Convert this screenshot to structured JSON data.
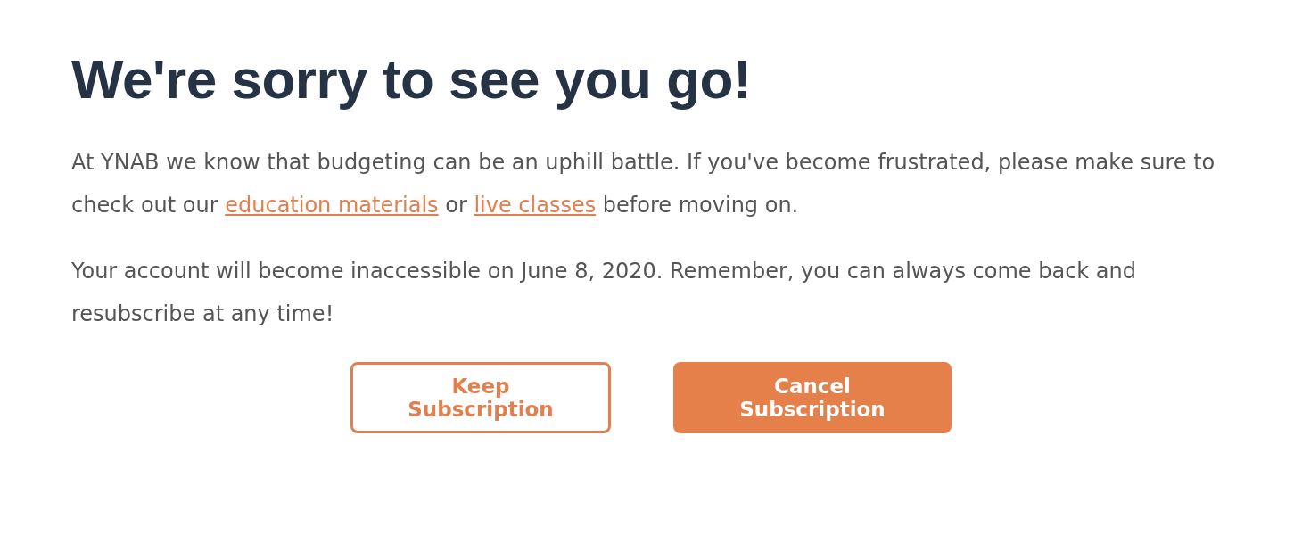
{
  "title": "We're sorry to see you go!",
  "paragraphs": [
    {
      "parts": [
        {
          "kind": "text",
          "text": "At YNAB we know that budgeting can be an uphill battle. If you've become frustrated, please make sure to check out our "
        },
        {
          "kind": "link",
          "text": "education materials"
        },
        {
          "kind": "text",
          "text": " or "
        },
        {
          "kind": "link",
          "text": "live classes"
        },
        {
          "kind": "text",
          "text": " before moving on."
        }
      ]
    },
    {
      "parts": [
        {
          "kind": "text",
          "text": "Your account will become inaccessible on June 8, 2020. Remember, you can always come back and resubscribe at any time!"
        }
      ]
    }
  ],
  "buttons": [
    {
      "kind": "secondary",
      "label": "Keep Subscription"
    },
    {
      "kind": "primary",
      "label": "Cancel Subscription"
    }
  ]
}
